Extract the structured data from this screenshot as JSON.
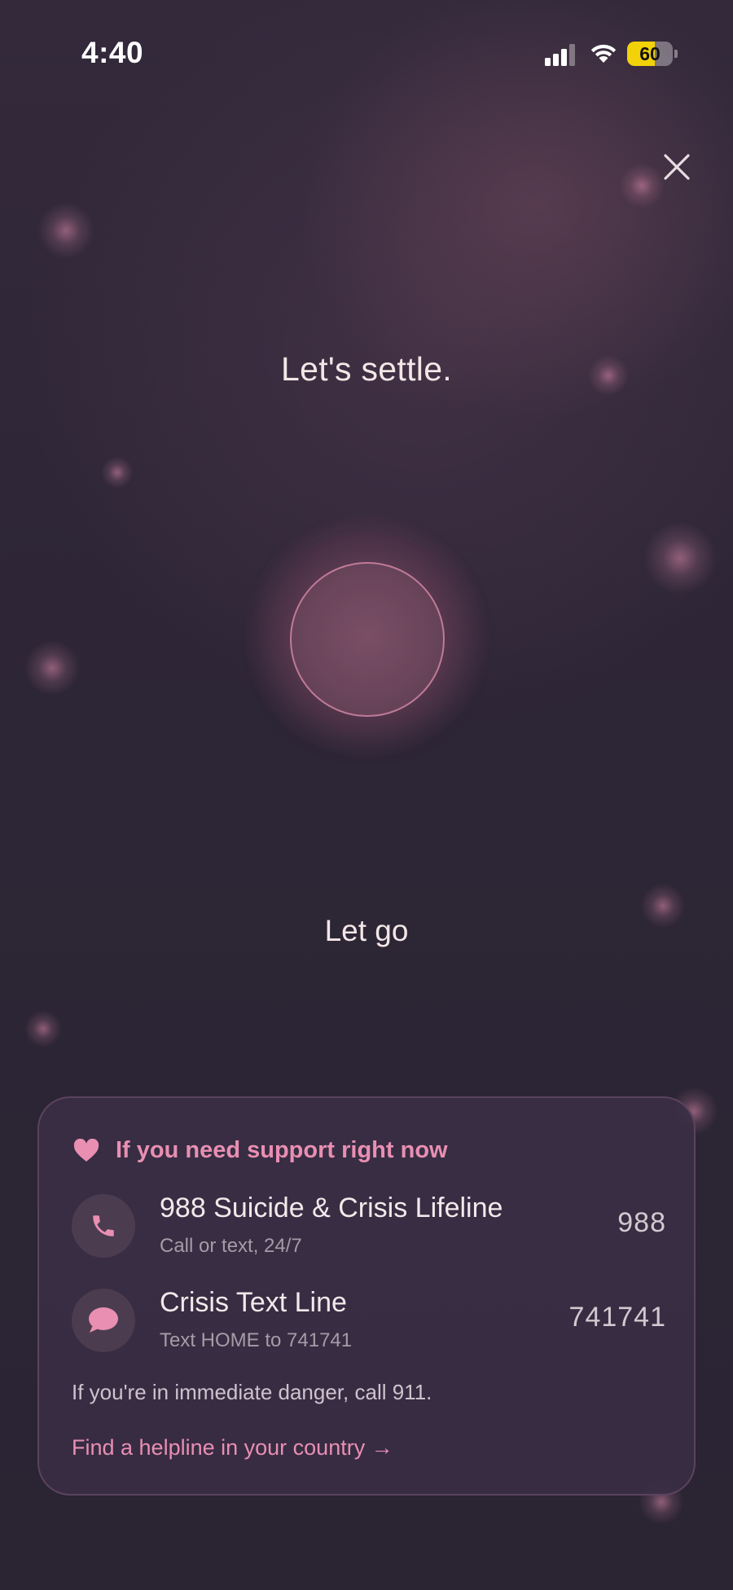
{
  "status_bar": {
    "time": "4:40",
    "battery_level": "60",
    "battery_fraction": 0.6,
    "icons": [
      "signal-icon",
      "wifi-icon",
      "battery-icon"
    ]
  },
  "close_icon": "close-icon",
  "heading": "Let's settle.",
  "instruction": "Let go",
  "support": {
    "title": "If you need support right now",
    "title_icon": "heart-icon",
    "helplines": [
      {
        "icon": "phone-icon",
        "name": "988 Suicide & Crisis Lifeline",
        "description": "Call or text, 24/7",
        "number": "988"
      },
      {
        "icon": "chat-bubble-icon",
        "name": "Crisis Text Line",
        "description": "Text HOME to 741741",
        "number": "741741"
      }
    ],
    "danger_notice": "If you're in immediate danger, call 911.",
    "find_link": "Find a helpline in your country →"
  },
  "colors": {
    "background": "#2a2333",
    "accent_pink": "#e88fb2",
    "text_light": "#f3e6e6",
    "battery_yellow": "#f2d208"
  }
}
